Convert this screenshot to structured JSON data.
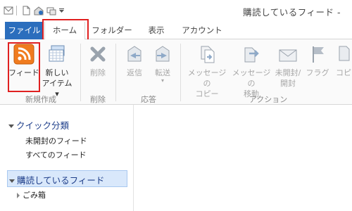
{
  "window": {
    "title": "購読しているフィード - "
  },
  "tabs": {
    "file": "ファイル",
    "home": "ホーム",
    "folder": "フォルダー",
    "view": "表示",
    "account": "アカウント"
  },
  "ribbon": {
    "feed": "フィード",
    "new_item_line1": "新しい",
    "new_item_line2": "アイテム ▾",
    "delete": "削除",
    "reply": "返信",
    "forward": "転送",
    "forward_arrow": "▾",
    "msg_copy_1": "メッセージの",
    "msg_copy_2": "コピー",
    "msg_move_1": "メッセージの",
    "msg_move_2": "移動",
    "unread_1": "未開封/",
    "unread_2": "開封",
    "flag": "フラグ",
    "copy_partial": "コピ",
    "groups": {
      "new": "新規作成",
      "delete": "削除",
      "respond": "応答",
      "actions": "アクション"
    }
  },
  "sidebar": {
    "quick_views": "クイック分類",
    "unread_feeds": "未開封のフィード",
    "all_feeds": "すべてのフィード",
    "subscribed": "購読しているフィード",
    "trash": "ごみ箱"
  },
  "colors": {
    "file_tab": "#2b6ebd",
    "highlight": "#e02020",
    "rss": "#f07b1e",
    "selection": "#d9e8fb"
  }
}
